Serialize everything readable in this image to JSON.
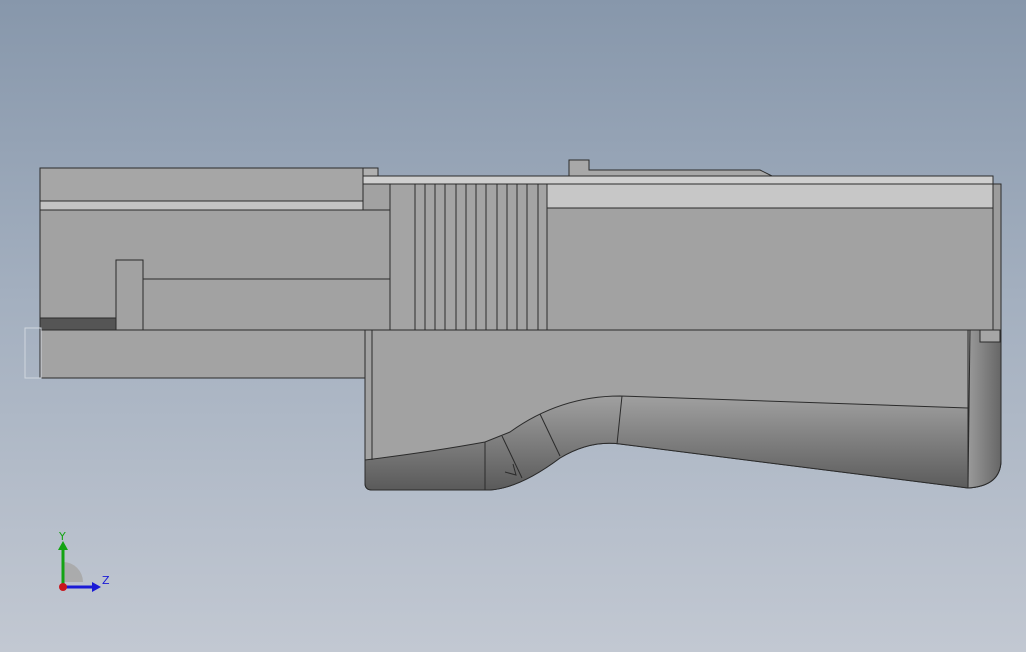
{
  "viewport": {
    "background_top": "#8797ab",
    "background_bottom": "#c2c8d2"
  },
  "model": {
    "part": "grip-housing",
    "face_color": "#a3a3a3",
    "edge_color": "#2b2b2b",
    "dark_insert_color": "#555555"
  },
  "triad": {
    "y_label": "Y",
    "z_label": "Z",
    "y_color": "#13a313",
    "z_color": "#1a1ad6",
    "x_color": "#c8161d"
  }
}
